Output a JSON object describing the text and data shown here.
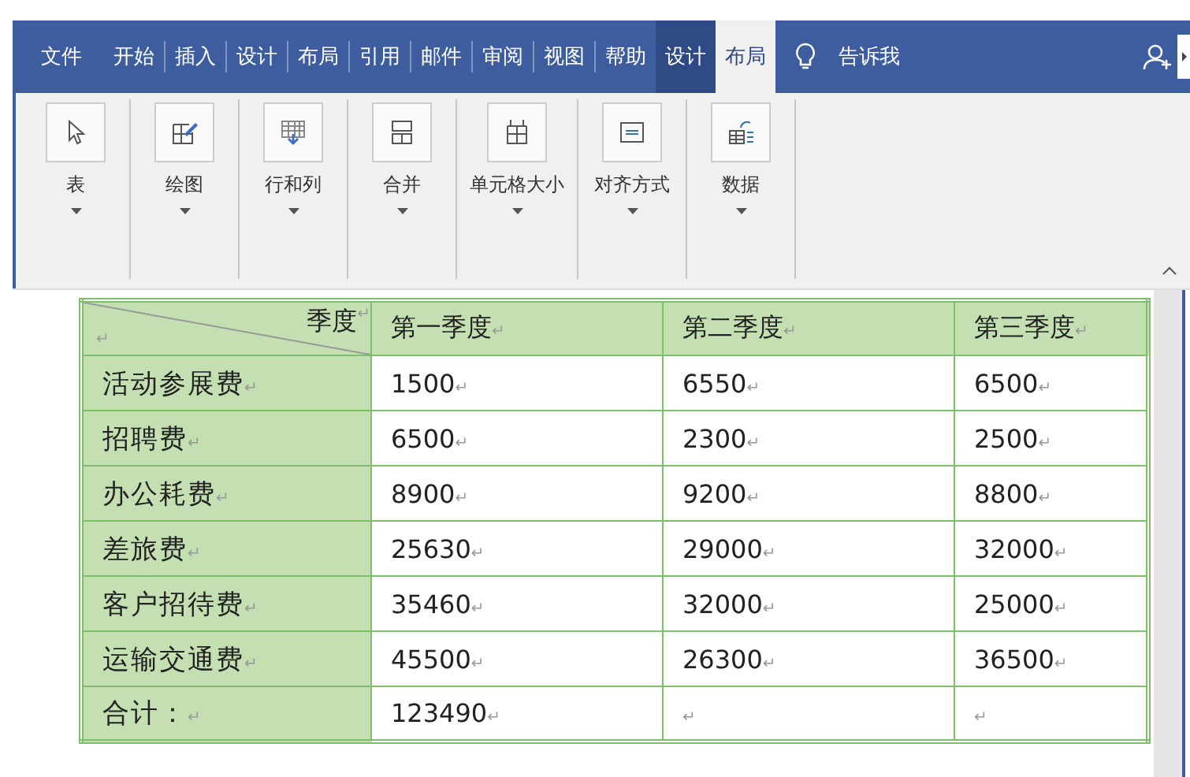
{
  "ribbon_tabs": [
    {
      "label": "文件",
      "kind": "file",
      "selected": false
    },
    {
      "label": "开始",
      "kind": "tab",
      "selected": false
    },
    {
      "label": "插入",
      "kind": "tab",
      "selected": false
    },
    {
      "label": "设计",
      "kind": "tab",
      "selected": false
    },
    {
      "label": "布局",
      "kind": "tab",
      "selected": false
    },
    {
      "label": "引用",
      "kind": "tab",
      "selected": false
    },
    {
      "label": "邮件",
      "kind": "tab",
      "selected": false
    },
    {
      "label": "审阅",
      "kind": "tab",
      "selected": false
    },
    {
      "label": "视图",
      "kind": "tab",
      "selected": false
    },
    {
      "label": "帮助",
      "kind": "tab",
      "selected": false
    },
    {
      "label": "设计",
      "kind": "context",
      "selected": false
    },
    {
      "label": "布局",
      "kind": "context",
      "selected": true
    }
  ],
  "tell_me": {
    "label": "告诉我"
  },
  "ribbon_groups": [
    {
      "label": "表"
    },
    {
      "label": "绘图"
    },
    {
      "label": "行和列"
    },
    {
      "label": "合并"
    },
    {
      "label": "单元格大小"
    },
    {
      "label": "对齐方式"
    },
    {
      "label": "数据"
    }
  ],
  "table": {
    "corner": {
      "top": "季度",
      "top_mark": "↵",
      "bottom_mark": "↵"
    },
    "columns": [
      {
        "text": "第一季度",
        "mark": "↵"
      },
      {
        "text": "第二季度",
        "mark": "↵"
      },
      {
        "text": "第三季度",
        "mark": "↵"
      }
    ],
    "rows": [
      {
        "label": {
          "text": "活动参展费",
          "mark": "↵"
        },
        "cells": [
          {
            "text": "1500",
            "mark": "↵"
          },
          {
            "text": "6550",
            "mark": "↵"
          },
          {
            "text": "6500",
            "mark": "↵"
          }
        ]
      },
      {
        "label": {
          "text": "招聘费",
          "mark": "↵"
        },
        "cells": [
          {
            "text": "6500",
            "mark": "↵"
          },
          {
            "text": "2300",
            "mark": "↵"
          },
          {
            "text": "2500",
            "mark": "↵"
          }
        ]
      },
      {
        "label": {
          "text": "办公耗费",
          "mark": "↵"
        },
        "cells": [
          {
            "text": "8900",
            "mark": "↵"
          },
          {
            "text": "9200",
            "mark": "↵"
          },
          {
            "text": "8800",
            "mark": "↵"
          }
        ]
      },
      {
        "label": {
          "text": "差旅费",
          "mark": "↵"
        },
        "cells": [
          {
            "text": "25630",
            "mark": "↵"
          },
          {
            "text": "29000",
            "mark": "↵"
          },
          {
            "text": "32000",
            "mark": "↵"
          }
        ]
      },
      {
        "label": {
          "text": "客户招待费",
          "mark": "↵"
        },
        "cells": [
          {
            "text": "35460",
            "mark": "↵"
          },
          {
            "text": "32000",
            "mark": "↵"
          },
          {
            "text": "25000",
            "mark": "↵"
          }
        ]
      },
      {
        "label": {
          "text": "运输交通费",
          "mark": "↵"
        },
        "cells": [
          {
            "text": "45500",
            "mark": "↵"
          },
          {
            "text": "26300",
            "mark": "↵"
          },
          {
            "text": "36500",
            "mark": "↵"
          }
        ]
      },
      {
        "label": {
          "text": "合计：",
          "mark": "↵"
        },
        "cells": [
          {
            "text": "123490",
            "mark": "↵"
          },
          {
            "mark": "↵"
          },
          {
            "mark": "↵"
          }
        ]
      }
    ]
  }
}
